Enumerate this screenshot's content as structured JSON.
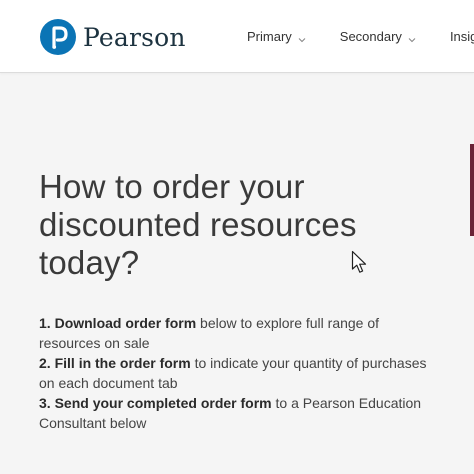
{
  "header": {
    "brand": "Pearson",
    "logo_icon": "pearson-p-logo",
    "nav": [
      {
        "label": "Primary",
        "icon": "chevron-down-icon"
      },
      {
        "label": "Secondary",
        "icon": "chevron-down-icon"
      },
      {
        "label": "Insights"
      }
    ]
  },
  "main": {
    "heading": "How to order your discounted resources today?",
    "steps": [
      {
        "number": "1.",
        "bold": "Download order form",
        "text": " below to explore full range of resources on sale"
      },
      {
        "number": "2.",
        "bold": "Fill in the order form",
        "text": " to indicate your quantity of purchases on each document tab"
      },
      {
        "number": "3.",
        "bold": "Send your completed order form",
        "text": " to a Pearson Education Consultant below"
      }
    ]
  },
  "colors": {
    "brand_blue": "#0b74b5",
    "accent_maroon": "#6b2336",
    "text": "#3a3a3a"
  }
}
